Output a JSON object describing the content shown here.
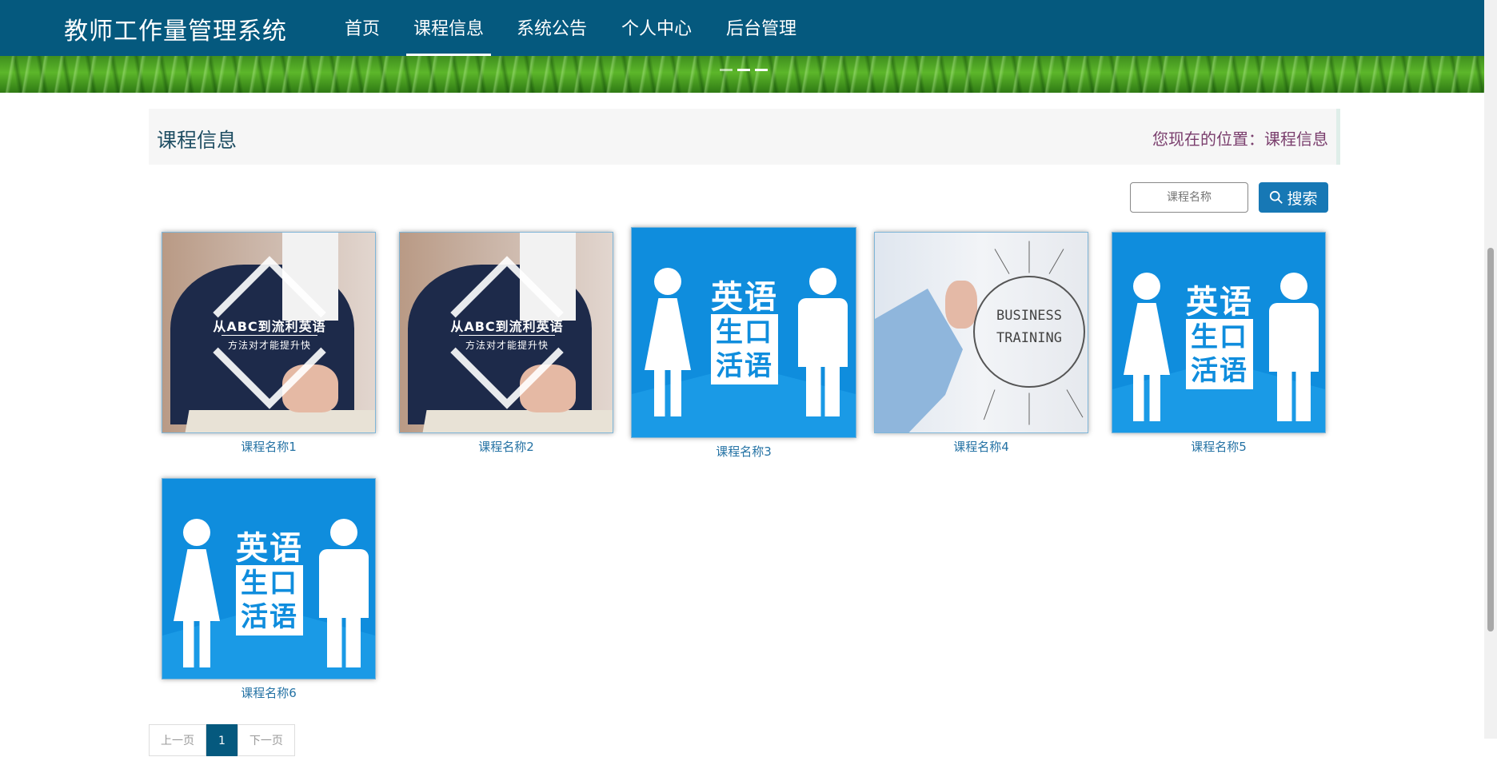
{
  "header": {
    "brand": "教师工作量管理系统",
    "nav": [
      {
        "label": "首页",
        "active": false
      },
      {
        "label": "课程信息",
        "active": true
      },
      {
        "label": "系统公告",
        "active": false
      },
      {
        "label": "个人中心",
        "active": false
      },
      {
        "label": "后台管理",
        "active": false
      }
    ]
  },
  "page": {
    "title": "课程信息",
    "breadcrumb": "您现在的位置：课程信息"
  },
  "search": {
    "placeholder": "课程名称",
    "button_label": "搜索"
  },
  "courses": [
    {
      "name": "课程名称1",
      "image": "student-english",
      "image_text": [
        "从ABC到流利英语",
        "方法对才能提升快"
      ]
    },
    {
      "name": "课程名称2",
      "image": "student-english",
      "image_text": [
        "从ABC到流利英语",
        "方法对才能提升快"
      ]
    },
    {
      "name": "课程名称3",
      "image": "spoken-english",
      "image_text": [
        "英语",
        "生口",
        "活语"
      ]
    },
    {
      "name": "课程名称4",
      "image": "business-training",
      "image_text": [
        "BUSINESS",
        "TRAINING"
      ]
    },
    {
      "name": "课程名称5",
      "image": "spoken-english",
      "image_text": [
        "英语",
        "生口",
        "活语"
      ]
    },
    {
      "name": "课程名称6",
      "image": "spoken-english",
      "image_text": [
        "英语",
        "生口",
        "活语"
      ]
    }
  ],
  "pagination": {
    "prev": "上一页",
    "current": "1",
    "next": "下一页"
  },
  "colors": {
    "nav_bg": "#05597e",
    "accent": "#1778b5",
    "caption": "#2472a4",
    "breadcrumb": "#7a3e6d"
  }
}
